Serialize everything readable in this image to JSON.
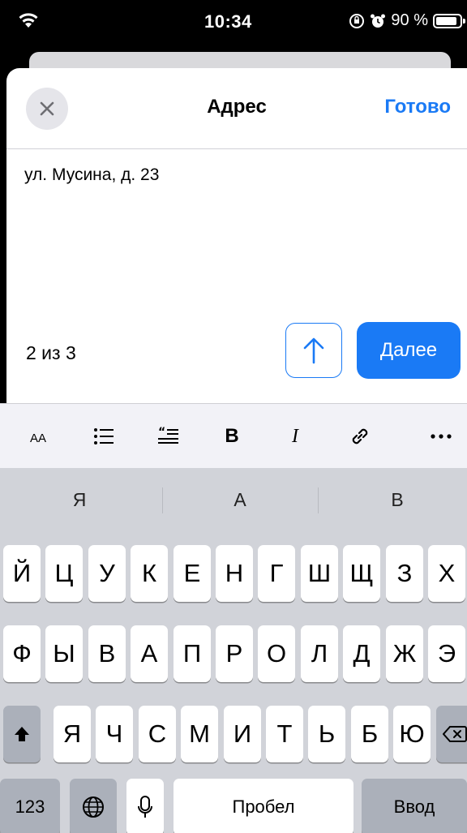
{
  "status_bar": {
    "time": "10:34",
    "battery_percent_label": "90 %",
    "battery_level": 0.9,
    "icons": [
      "wifi-icon",
      "orientation-lock-icon",
      "alarm-icon",
      "battery-icon"
    ]
  },
  "sheet": {
    "title": "Адрес",
    "close_icon": "close-icon",
    "done_label": "Готово",
    "address_value": "ул. Мусина, д. 23",
    "counter_label": "2 из 3",
    "up_icon": "arrow-up-icon",
    "next_label": "Далее"
  },
  "format_toolbar": {
    "text_size_label": "AA",
    "bold_label": "B",
    "italic_label": "I",
    "icons": [
      "text-size-icon",
      "list-icon",
      "quote-icon",
      "bold-icon",
      "italic-icon",
      "link-icon",
      "more-icon"
    ]
  },
  "keyboard": {
    "suggestions": [
      "Я",
      "А",
      "В"
    ],
    "row1": [
      "Й",
      "Ц",
      "У",
      "К",
      "Е",
      "Н",
      "Г",
      "Ш",
      "Щ",
      "З",
      "Х"
    ],
    "row2": [
      "Ф",
      "Ы",
      "В",
      "А",
      "П",
      "Р",
      "О",
      "Л",
      "Д",
      "Ж",
      "Э"
    ],
    "row3": [
      "Я",
      "Ч",
      "С",
      "М",
      "И",
      "Т",
      "Ь",
      "Б",
      "Ю"
    ],
    "numbers_label": "123",
    "space_label": "Пробел",
    "return_label": "Ввод",
    "icons": [
      "shift-icon",
      "delete-icon",
      "globe-icon",
      "microphone-icon"
    ]
  },
  "colors": {
    "accent": "#1a7af5",
    "keyboard_bg": "#d1d3d9",
    "key_dark": "#abb0ba"
  }
}
